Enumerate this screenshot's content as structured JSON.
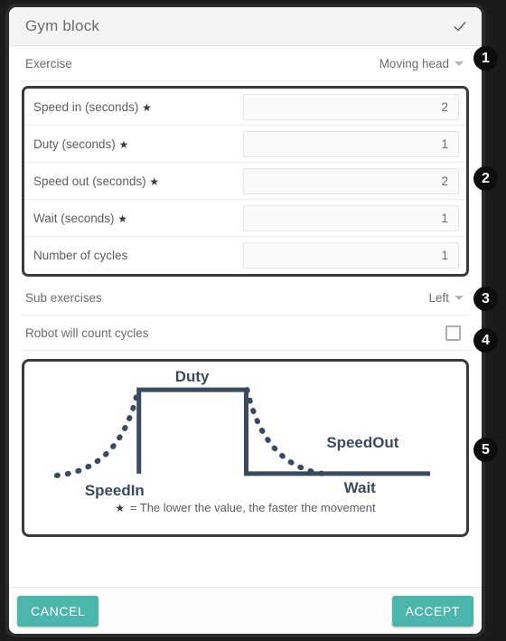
{
  "dialog": {
    "title": "Gym block",
    "confirm_icon": "check-icon"
  },
  "exercise_row": {
    "label": "Exercise",
    "value": "Moving head"
  },
  "fields": [
    {
      "label": "Speed in (seconds)",
      "required_star": "★",
      "value": "2"
    },
    {
      "label": "Duty (seconds)",
      "required_star": "★",
      "value": "1"
    },
    {
      "label": "Speed out (seconds)",
      "required_star": "★",
      "value": "2"
    },
    {
      "label": "Wait (seconds)",
      "required_star": "★",
      "value": "1"
    },
    {
      "label": "Number of cycles",
      "required_star": "",
      "value": "1"
    }
  ],
  "sub_exercises_row": {
    "label": "Sub exercises",
    "value": "Left"
  },
  "count_cycles_row": {
    "label": "Robot will count cycles",
    "checked": false
  },
  "diagram": {
    "labels": {
      "duty": "Duty",
      "speed_in": "SpeedIn",
      "speed_out": "SpeedOut",
      "wait": "Wait"
    },
    "note_star": "★",
    "note": "= The lower the value, the faster the movement",
    "line_color": "#3b4a5e"
  },
  "footer": {
    "cancel_label": "CANCEL",
    "accept_label": "ACCEPT",
    "accent_color": "#4db6ac"
  },
  "badges": [
    {
      "number": "1"
    },
    {
      "number": "2"
    },
    {
      "number": "3"
    },
    {
      "number": "4"
    },
    {
      "number": "5"
    }
  ]
}
